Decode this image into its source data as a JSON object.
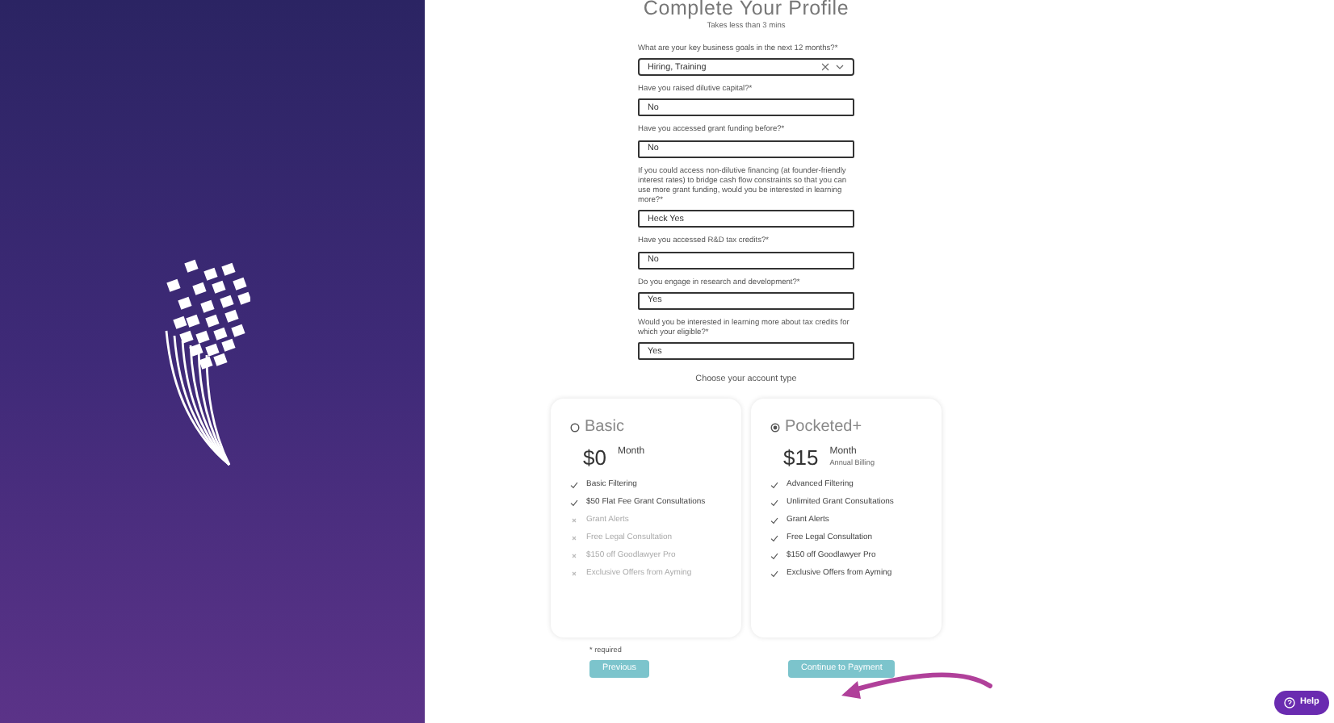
{
  "title": "Complete Your Profile",
  "subtitle": "Takes less than 3 mins",
  "questions": [
    {
      "kind": "select",
      "label": "What are your key business goals in the next 12 months?*",
      "value": "Hiring, Training"
    },
    {
      "kind": "text",
      "label": "Have you raised dilutive capital?*",
      "value": "No"
    },
    {
      "kind": "text",
      "label": "Have you accessed grant funding before?*",
      "value": "No"
    },
    {
      "kind": "text",
      "label": "If you could access non-dilutive financing (at founder-friendly interest rates) to bridge cash flow constraints so that you can use more grant funding, would you be interested in learning more?*",
      "value": "Heck Yes"
    },
    {
      "kind": "text",
      "label": "Have you accessed R&D tax credits?*",
      "value": "No"
    },
    {
      "kind": "text",
      "label": "Do you engage in research and development?*",
      "value": "Yes"
    },
    {
      "kind": "text",
      "label": "Would you be interested in learning more about tax credits for which your eligible?*",
      "value": "Yes"
    }
  ],
  "account_prompt": "Choose your account type",
  "plans": [
    {
      "name": "Basic",
      "selected": false,
      "price": "$0",
      "period": "Month",
      "features": [
        {
          "text": "Basic Filtering",
          "included": true
        },
        {
          "text": "$50 Flat Fee Grant Consultations",
          "included": true
        },
        {
          "text": "Grant Alerts",
          "included": false
        },
        {
          "text": "Free Legal Consultation",
          "included": false
        },
        {
          "text": "$150 off Goodlawyer Pro",
          "included": false
        },
        {
          "text": "Exclusive Offers from Ayming",
          "included": false
        }
      ]
    },
    {
      "name": "Pocketed+",
      "selected": true,
      "price": "$15",
      "period": "Month",
      "billing": "Annual Billing",
      "features": [
        {
          "text": "Advanced Filtering",
          "included": true
        },
        {
          "text": "Unlimited Grant Consultations",
          "included": true
        },
        {
          "text": "Grant Alerts",
          "included": true
        },
        {
          "text": "Free Legal Consultation",
          "included": true
        },
        {
          "text": "$150 off Goodlawyer Pro",
          "included": true
        },
        {
          "text": "Exclusive Offers from Ayming",
          "included": true
        }
      ]
    }
  ],
  "required_note": "* required",
  "buttons": {
    "previous": "Previous",
    "continue": "Continue to Payment"
  },
  "help": "Help"
}
